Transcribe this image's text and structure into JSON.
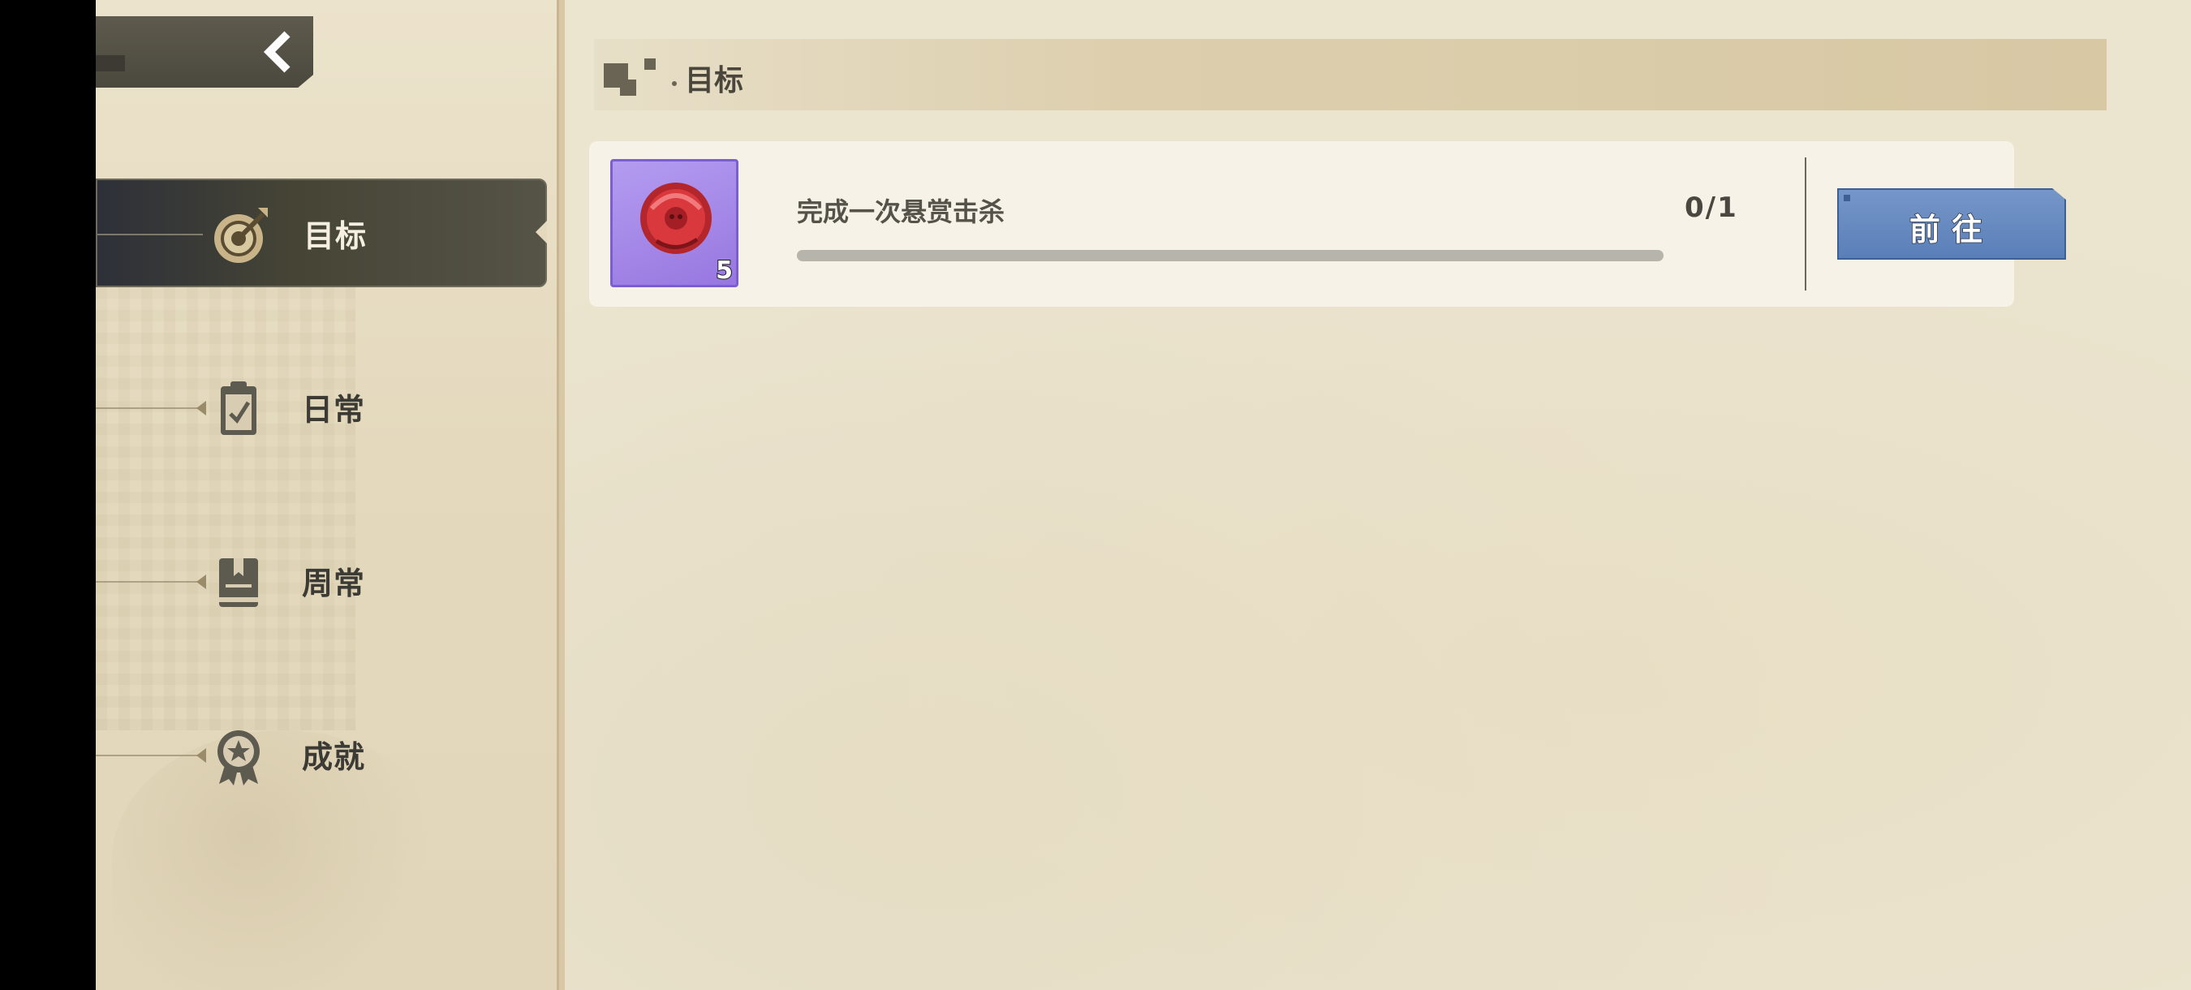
{
  "nav": {
    "items": [
      {
        "label": "目标",
        "icon": "target-icon",
        "active": true
      },
      {
        "label": "日常",
        "icon": "clipboard-icon",
        "active": false
      },
      {
        "label": "周常",
        "icon": "book-icon",
        "active": false
      },
      {
        "label": "成就",
        "icon": "medal-icon",
        "active": false
      }
    ]
  },
  "header": {
    "title": "目标"
  },
  "tasks": [
    {
      "title": "完成一次悬赏击杀",
      "progress_text": "0/1",
      "progress": 0,
      "reward": {
        "icon": "red-token-icon",
        "count": "5"
      },
      "action_label": "前往"
    }
  ],
  "colors": {
    "accent_blue": "#5a7fb8",
    "reward_purple": "#9777e0",
    "active_nav": "#464535"
  }
}
